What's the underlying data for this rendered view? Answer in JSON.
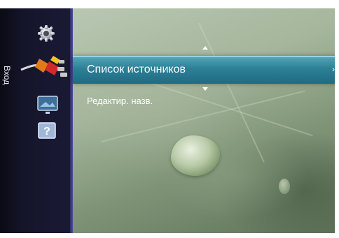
{
  "sidebar": {
    "section_label": "Вход",
    "icons": [
      {
        "name": "gear-icon",
        "selected": false
      },
      {
        "name": "input-cable-icon",
        "selected": true
      },
      {
        "name": "picture-icon",
        "selected": false
      },
      {
        "name": "help-icon",
        "selected": false,
        "glyph": "?"
      }
    ]
  },
  "menu": {
    "items": [
      {
        "label": "Список источников",
        "selected": true,
        "has_submenu": true
      },
      {
        "label": "Редактир. назв.",
        "selected": false
      }
    ],
    "submenu_arrow": "›"
  },
  "colors": {
    "highlight": "#2d8096",
    "sidebar": "#1a1a36",
    "text": "#ffffff"
  }
}
